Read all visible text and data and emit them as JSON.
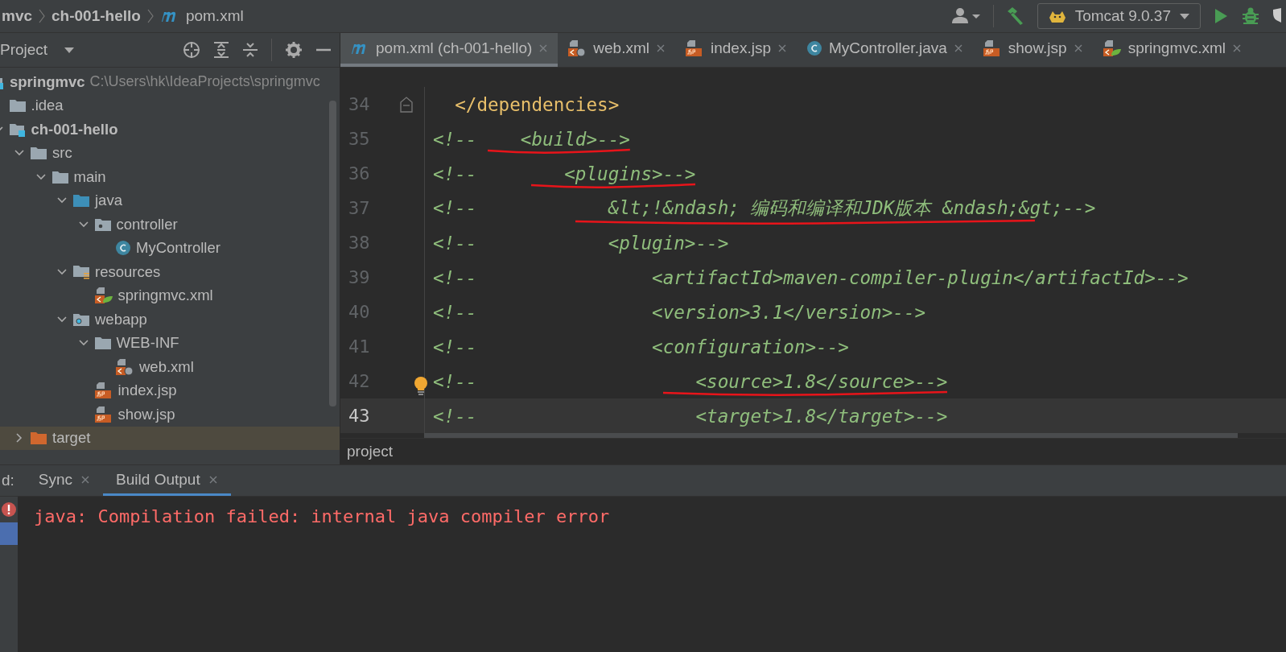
{
  "breadcrumbs": [
    {
      "label": "mvc",
      "kind": "module"
    },
    {
      "label": "ch-001-hello",
      "kind": "module"
    },
    {
      "label": "pom.xml",
      "kind": "maven"
    }
  ],
  "toolbar": {
    "run_config": "Tomcat 9.0.37"
  },
  "project_panel": {
    "title": "Project",
    "tree": [
      {
        "label": "springmvc",
        "kind": "module",
        "path": "C:\\Users\\hk\\IdeaProjects\\springmvc",
        "selected": false,
        "children": [
          {
            "label": ".idea",
            "kind": "folder",
            "selected": false
          },
          {
            "label": "ch-001-hello",
            "kind": "module",
            "expanded": true,
            "selected": false,
            "children": [
              {
                "label": "src",
                "kind": "folder",
                "expanded": true,
                "selected": false,
                "children": [
                  {
                    "label": "main",
                    "kind": "folder",
                    "expanded": true,
                    "selected": false,
                    "children": [
                      {
                        "label": "java",
                        "kind": "source",
                        "expanded": true,
                        "selected": false,
                        "children": [
                          {
                            "label": "controller",
                            "kind": "package",
                            "expanded": true,
                            "selected": false,
                            "children": [
                              {
                                "label": "MyController",
                                "kind": "class",
                                "selected": false
                              }
                            ]
                          }
                        ]
                      },
                      {
                        "label": "resources",
                        "kind": "resources",
                        "expanded": true,
                        "selected": false,
                        "children": [
                          {
                            "label": "springmvc.xml",
                            "kind": "spring",
                            "selected": false
                          }
                        ]
                      },
                      {
                        "label": "webapp",
                        "kind": "web",
                        "expanded": true,
                        "selected": false,
                        "children": [
                          {
                            "label": "WEB-INF",
                            "kind": "folder",
                            "expanded": true,
                            "selected": false,
                            "children": [
                              {
                                "label": "web.xml",
                                "kind": "webxml",
                                "selected": false
                              }
                            ]
                          },
                          {
                            "label": "index.jsp",
                            "kind": "jsp",
                            "selected": false
                          },
                          {
                            "label": "show.jsp",
                            "kind": "jsp",
                            "selected": false
                          }
                        ]
                      }
                    ]
                  }
                ]
              },
              {
                "label": "target",
                "kind": "excluded",
                "expanded": false,
                "selected": true
              }
            ]
          }
        ]
      }
    ]
  },
  "editor": {
    "tabs": [
      {
        "label": "pom.xml (ch-001-hello)",
        "kind": "maven",
        "selected": true
      },
      {
        "label": "web.xml",
        "kind": "webxml",
        "selected": false
      },
      {
        "label": "index.jsp",
        "kind": "jsp",
        "selected": false
      },
      {
        "label": "MyController.java",
        "kind": "class",
        "selected": false
      },
      {
        "label": "show.jsp",
        "kind": "jsp",
        "selected": false
      },
      {
        "label": "springmvc.xml",
        "kind": "spring",
        "selected": false
      }
    ],
    "lines": [
      {
        "number": "34",
        "kind": "tag",
        "text": "  </dependencies>",
        "fold": true,
        "underlined": false,
        "bulb": false,
        "current": false
      },
      {
        "number": "35",
        "kind": "comment",
        "text": "<!--    <build>-->",
        "fold": false,
        "underlined": true,
        "bulb": false,
        "current": false
      },
      {
        "number": "36",
        "kind": "comment",
        "text": "<!--        <plugins>-->",
        "fold": false,
        "underlined": true,
        "bulb": false,
        "current": false
      },
      {
        "number": "37",
        "kind": "comment",
        "text": "<!--            &lt;!&ndash; 编码和编译和JDK版本 &ndash;&gt;-->",
        "fold": false,
        "underlined": true,
        "bulb": false,
        "current": false
      },
      {
        "number": "38",
        "kind": "comment",
        "text": "<!--            <plugin>-->",
        "fold": false,
        "underlined": false,
        "bulb": false,
        "current": false
      },
      {
        "number": "39",
        "kind": "comment",
        "text": "<!--                <artifactId>maven-compiler-plugin</artifactId>-->",
        "fold": false,
        "underlined": false,
        "bulb": false,
        "current": false
      },
      {
        "number": "40",
        "kind": "comment",
        "text": "<!--                <version>3.1</version>-->",
        "fold": false,
        "underlined": false,
        "bulb": false,
        "current": false
      },
      {
        "number": "41",
        "kind": "comment",
        "text": "<!--                <configuration>-->",
        "fold": false,
        "underlined": false,
        "bulb": false,
        "current": false
      },
      {
        "number": "42",
        "kind": "comment",
        "text": "<!--                    <source>1.8</source>-->",
        "fold": false,
        "underlined": true,
        "bulb": true,
        "current": false
      },
      {
        "number": "43",
        "kind": "comment",
        "text": "<!--                    <target>1.8</target>-->",
        "fold": false,
        "underlined": false,
        "bulb": false,
        "current": true
      }
    ],
    "breadcrumb": "project"
  },
  "bottom_panel": {
    "label": "d:",
    "tabs": [
      {
        "label": "Sync",
        "selected": false
      },
      {
        "label": "Build Output",
        "selected": true
      }
    ],
    "output": "java: Compilation failed: internal java compiler error"
  }
}
